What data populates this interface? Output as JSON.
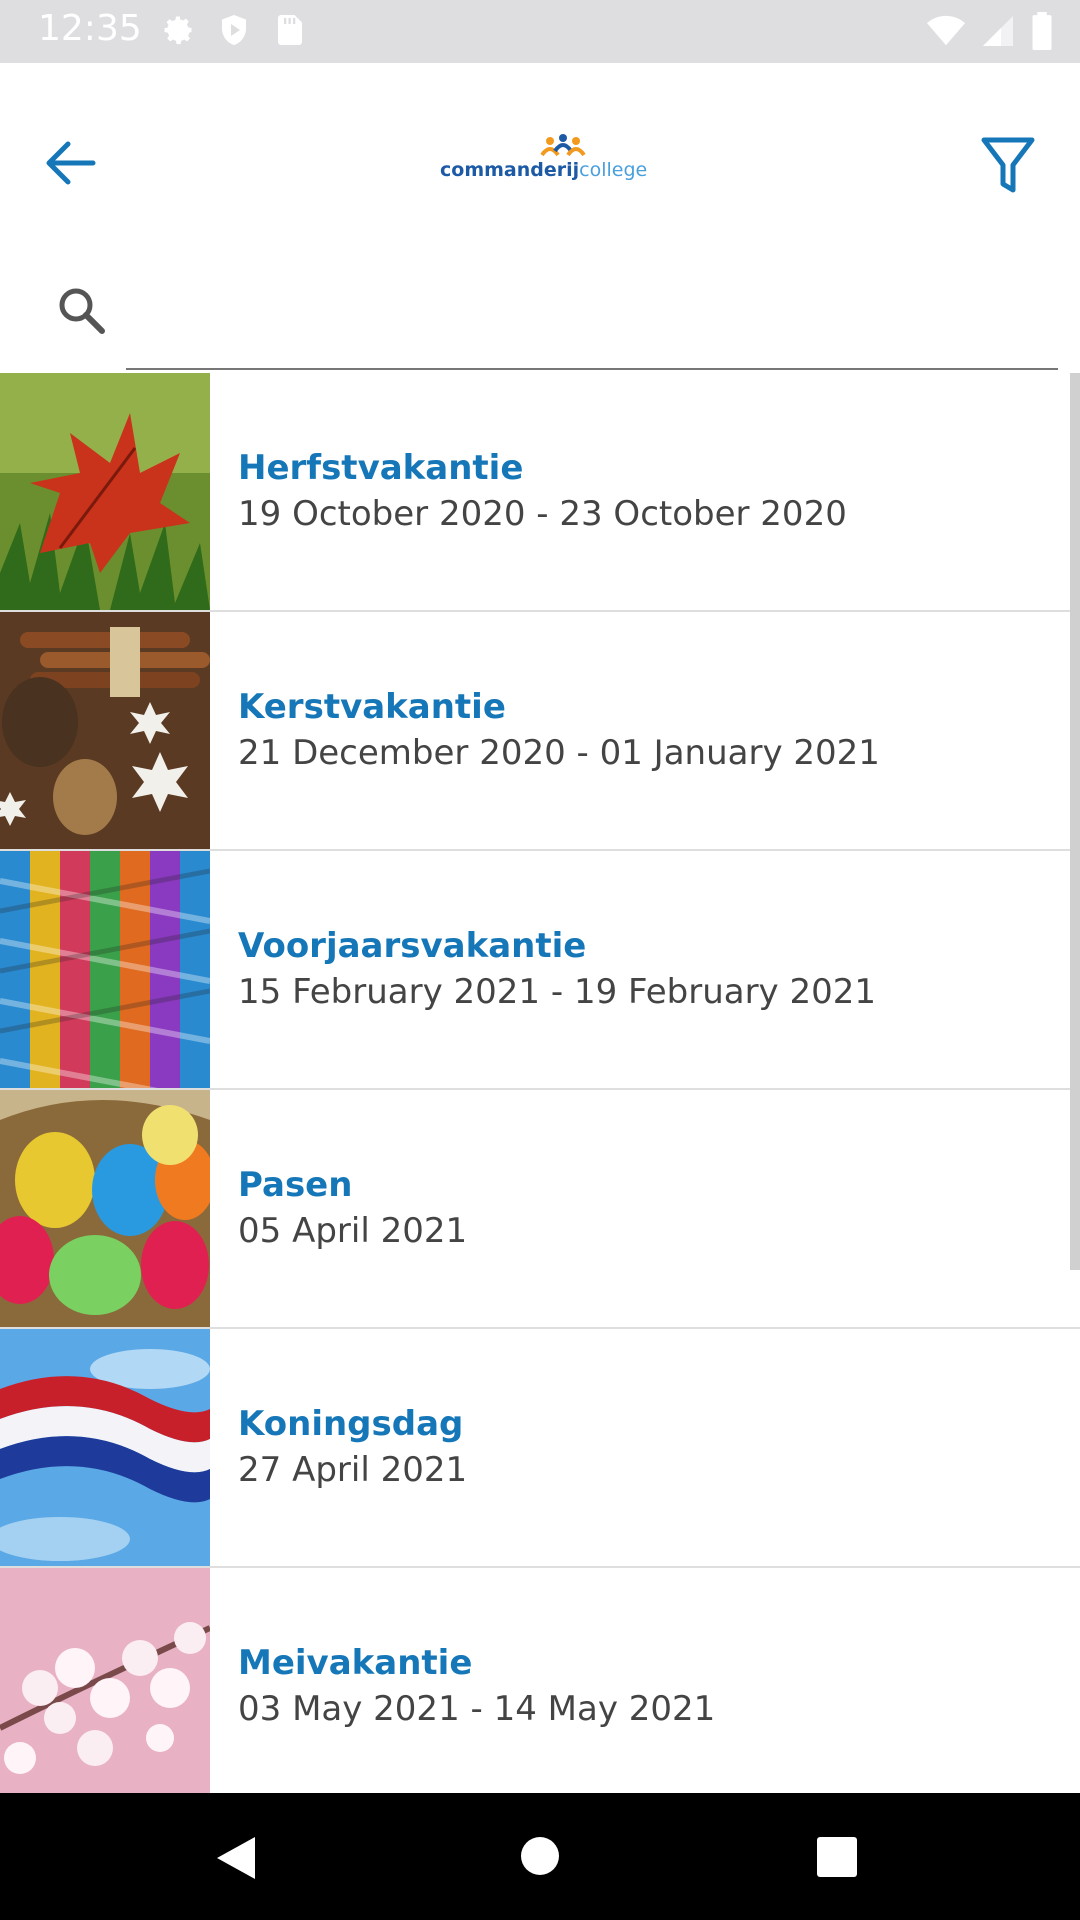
{
  "status_bar": {
    "time": "12:35",
    "left_icons": [
      "settings-icon",
      "shield-play-icon",
      "sd-card-icon"
    ],
    "right_icons": [
      "wifi-icon",
      "signal-icon",
      "battery-icon"
    ]
  },
  "app_bar": {
    "back_icon": "arrow-left-icon",
    "filter_icon": "filter-icon",
    "logo": {
      "part1": "commanderij",
      "part2": "college"
    },
    "accent_color": "#1677b8"
  },
  "search": {
    "icon": "search-icon",
    "value": "",
    "placeholder": ""
  },
  "events": [
    {
      "title": "Herfstvakantie",
      "date": "19 October 2020 - 23 October 2020",
      "image": "autumn-leaf"
    },
    {
      "title": "Kerstvakantie",
      "date": "21 December 2020 - 01 January 2021",
      "image": "christmas-spices"
    },
    {
      "title": "Voorjaarsvakantie",
      "date": "15 February 2021 - 19 February 2021",
      "image": "carnival-streamers"
    },
    {
      "title": "Pasen",
      "date": "05 April 2021",
      "image": "easter-eggs"
    },
    {
      "title": "Koningsdag",
      "date": "27 April 2021",
      "image": "dutch-flag"
    },
    {
      "title": "Meivakantie",
      "date": "03 May 2021 - 14 May 2021",
      "image": "cherry-blossom"
    }
  ],
  "nav_bar": {
    "back": "nav-back-icon",
    "home": "nav-home-icon",
    "recents": "nav-recents-icon"
  }
}
